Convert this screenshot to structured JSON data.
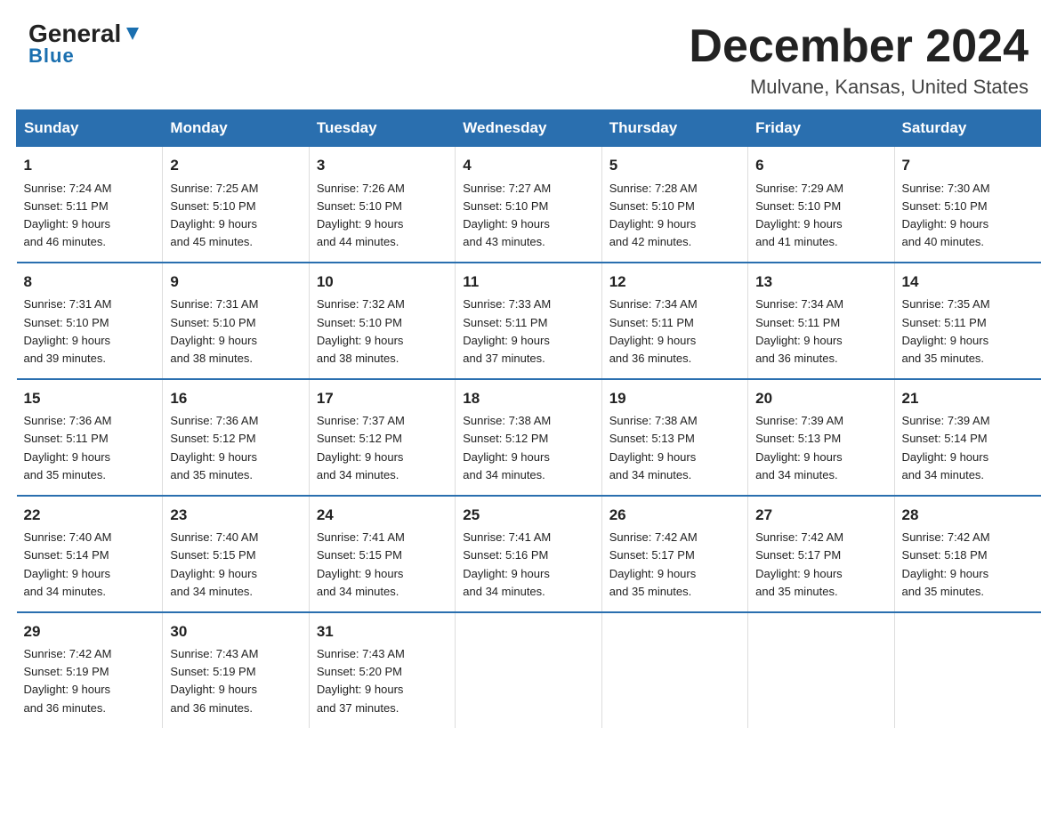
{
  "logo": {
    "general": "General",
    "blue": "Blue"
  },
  "title": {
    "month": "December 2024",
    "location": "Mulvane, Kansas, United States"
  },
  "header_days": [
    "Sunday",
    "Monday",
    "Tuesday",
    "Wednesday",
    "Thursday",
    "Friday",
    "Saturday"
  ],
  "weeks": [
    [
      {
        "day": "1",
        "info": "Sunrise: 7:24 AM\nSunset: 5:11 PM\nDaylight: 9 hours\nand 46 minutes."
      },
      {
        "day": "2",
        "info": "Sunrise: 7:25 AM\nSunset: 5:10 PM\nDaylight: 9 hours\nand 45 minutes."
      },
      {
        "day": "3",
        "info": "Sunrise: 7:26 AM\nSunset: 5:10 PM\nDaylight: 9 hours\nand 44 minutes."
      },
      {
        "day": "4",
        "info": "Sunrise: 7:27 AM\nSunset: 5:10 PM\nDaylight: 9 hours\nand 43 minutes."
      },
      {
        "day": "5",
        "info": "Sunrise: 7:28 AM\nSunset: 5:10 PM\nDaylight: 9 hours\nand 42 minutes."
      },
      {
        "day": "6",
        "info": "Sunrise: 7:29 AM\nSunset: 5:10 PM\nDaylight: 9 hours\nand 41 minutes."
      },
      {
        "day": "7",
        "info": "Sunrise: 7:30 AM\nSunset: 5:10 PM\nDaylight: 9 hours\nand 40 minutes."
      }
    ],
    [
      {
        "day": "8",
        "info": "Sunrise: 7:31 AM\nSunset: 5:10 PM\nDaylight: 9 hours\nand 39 minutes."
      },
      {
        "day": "9",
        "info": "Sunrise: 7:31 AM\nSunset: 5:10 PM\nDaylight: 9 hours\nand 38 minutes."
      },
      {
        "day": "10",
        "info": "Sunrise: 7:32 AM\nSunset: 5:10 PM\nDaylight: 9 hours\nand 38 minutes."
      },
      {
        "day": "11",
        "info": "Sunrise: 7:33 AM\nSunset: 5:11 PM\nDaylight: 9 hours\nand 37 minutes."
      },
      {
        "day": "12",
        "info": "Sunrise: 7:34 AM\nSunset: 5:11 PM\nDaylight: 9 hours\nand 36 minutes."
      },
      {
        "day": "13",
        "info": "Sunrise: 7:34 AM\nSunset: 5:11 PM\nDaylight: 9 hours\nand 36 minutes."
      },
      {
        "day": "14",
        "info": "Sunrise: 7:35 AM\nSunset: 5:11 PM\nDaylight: 9 hours\nand 35 minutes."
      }
    ],
    [
      {
        "day": "15",
        "info": "Sunrise: 7:36 AM\nSunset: 5:11 PM\nDaylight: 9 hours\nand 35 minutes."
      },
      {
        "day": "16",
        "info": "Sunrise: 7:36 AM\nSunset: 5:12 PM\nDaylight: 9 hours\nand 35 minutes."
      },
      {
        "day": "17",
        "info": "Sunrise: 7:37 AM\nSunset: 5:12 PM\nDaylight: 9 hours\nand 34 minutes."
      },
      {
        "day": "18",
        "info": "Sunrise: 7:38 AM\nSunset: 5:12 PM\nDaylight: 9 hours\nand 34 minutes."
      },
      {
        "day": "19",
        "info": "Sunrise: 7:38 AM\nSunset: 5:13 PM\nDaylight: 9 hours\nand 34 minutes."
      },
      {
        "day": "20",
        "info": "Sunrise: 7:39 AM\nSunset: 5:13 PM\nDaylight: 9 hours\nand 34 minutes."
      },
      {
        "day": "21",
        "info": "Sunrise: 7:39 AM\nSunset: 5:14 PM\nDaylight: 9 hours\nand 34 minutes."
      }
    ],
    [
      {
        "day": "22",
        "info": "Sunrise: 7:40 AM\nSunset: 5:14 PM\nDaylight: 9 hours\nand 34 minutes."
      },
      {
        "day": "23",
        "info": "Sunrise: 7:40 AM\nSunset: 5:15 PM\nDaylight: 9 hours\nand 34 minutes."
      },
      {
        "day": "24",
        "info": "Sunrise: 7:41 AM\nSunset: 5:15 PM\nDaylight: 9 hours\nand 34 minutes."
      },
      {
        "day": "25",
        "info": "Sunrise: 7:41 AM\nSunset: 5:16 PM\nDaylight: 9 hours\nand 34 minutes."
      },
      {
        "day": "26",
        "info": "Sunrise: 7:42 AM\nSunset: 5:17 PM\nDaylight: 9 hours\nand 35 minutes."
      },
      {
        "day": "27",
        "info": "Sunrise: 7:42 AM\nSunset: 5:17 PM\nDaylight: 9 hours\nand 35 minutes."
      },
      {
        "day": "28",
        "info": "Sunrise: 7:42 AM\nSunset: 5:18 PM\nDaylight: 9 hours\nand 35 minutes."
      }
    ],
    [
      {
        "day": "29",
        "info": "Sunrise: 7:42 AM\nSunset: 5:19 PM\nDaylight: 9 hours\nand 36 minutes."
      },
      {
        "day": "30",
        "info": "Sunrise: 7:43 AM\nSunset: 5:19 PM\nDaylight: 9 hours\nand 36 minutes."
      },
      {
        "day": "31",
        "info": "Sunrise: 7:43 AM\nSunset: 5:20 PM\nDaylight: 9 hours\nand 37 minutes."
      },
      {
        "day": "",
        "info": ""
      },
      {
        "day": "",
        "info": ""
      },
      {
        "day": "",
        "info": ""
      },
      {
        "day": "",
        "info": ""
      }
    ]
  ]
}
